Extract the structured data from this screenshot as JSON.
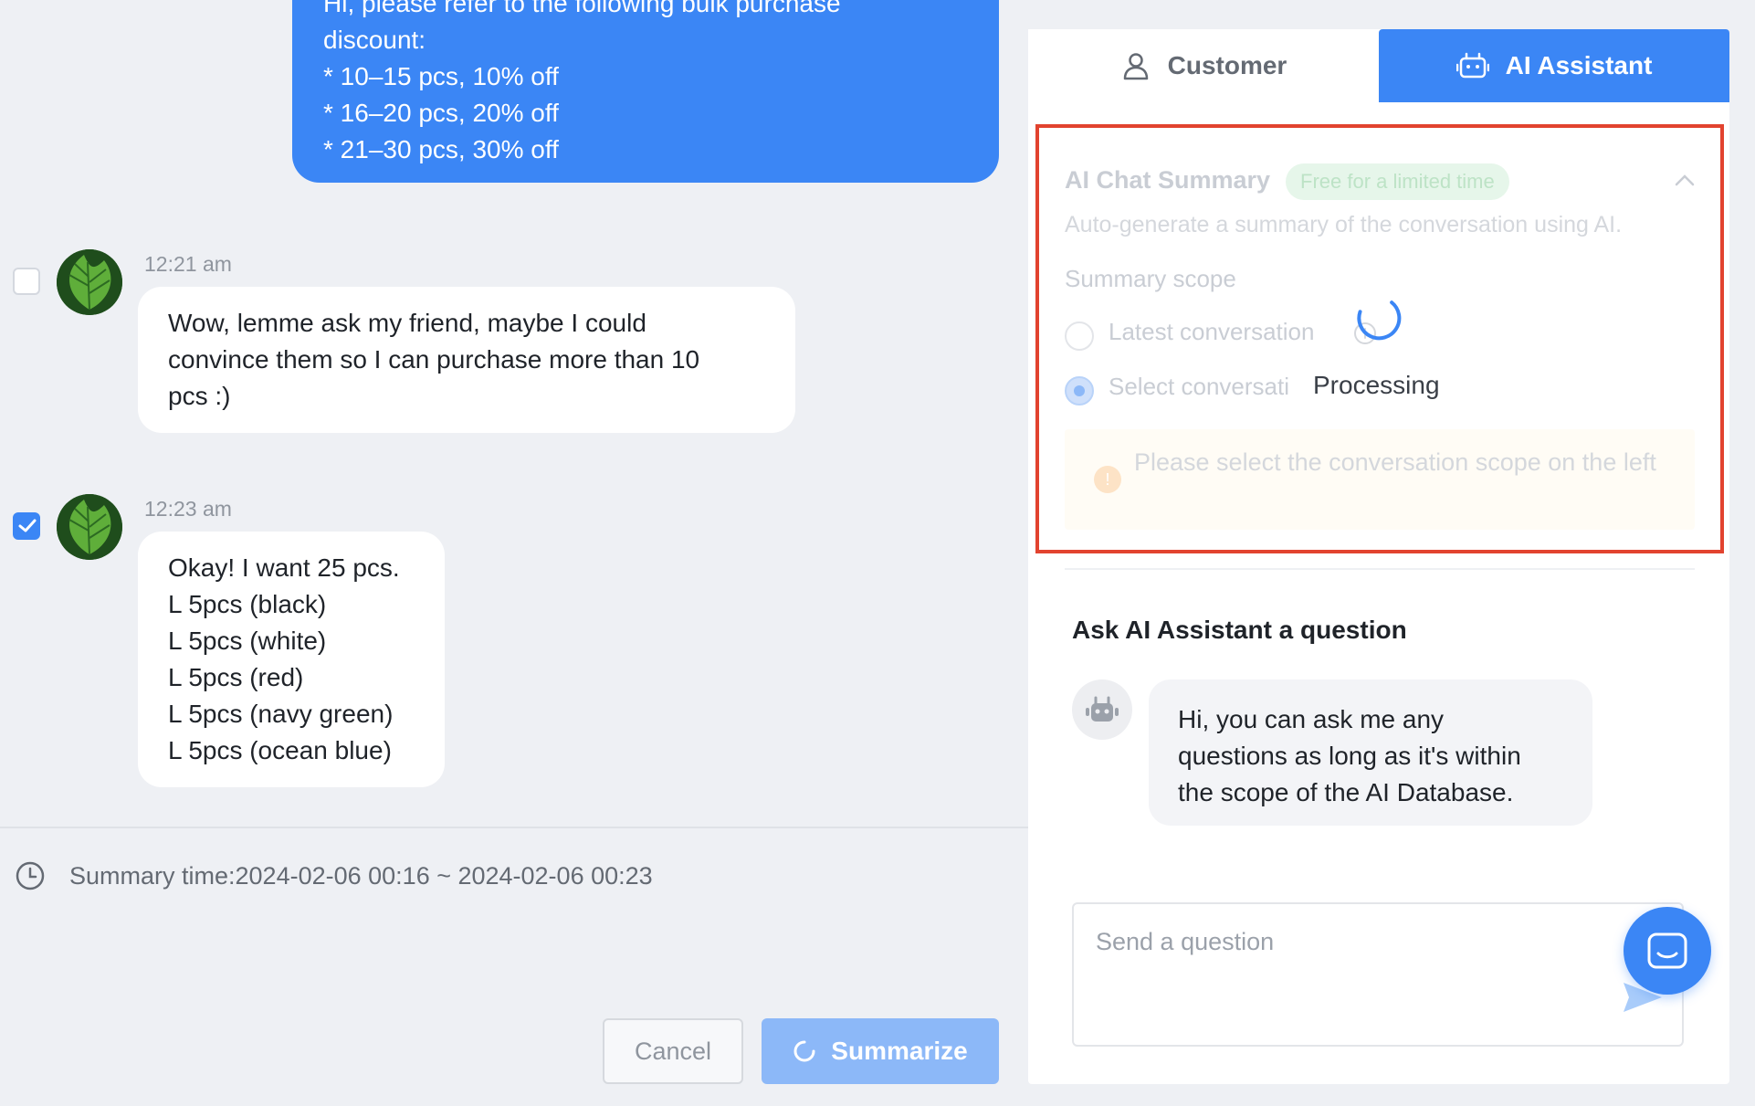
{
  "chat": {
    "agent_message": {
      "lines": [
        "Hi, please refer to the following bulk purchase",
        "discount:",
        "* 10–15 pcs, 10% off",
        "* 16–20 pcs, 20% off",
        "* 21–30 pcs, 30% off"
      ]
    },
    "messages": [
      {
        "time": "12:21 am",
        "checked": false,
        "lines": [
          "Wow, lemme ask my friend, maybe I could",
          "convince them so I can purchase more than 10",
          "pcs :)"
        ]
      },
      {
        "time": "12:23 am",
        "checked": true,
        "lines": [
          "Okay! I want 25 pcs.",
          "L 5pcs (black)",
          "L 5pcs (white)",
          "L 5pcs (red)",
          "L 5pcs (navy green)",
          "L 5pcs (ocean blue)"
        ]
      }
    ],
    "summary_time": "Summary time:2024-02-06 00:16 ~ 2024-02-06 00:23",
    "cancel_label": "Cancel",
    "summarize_label": "Summarize"
  },
  "panel": {
    "tabs": [
      {
        "label": "Customer",
        "icon": "user-icon",
        "active": false
      },
      {
        "label": "AI Assistant",
        "icon": "robot-icon",
        "active": true
      }
    ],
    "summary": {
      "title": "AI Chat Summary",
      "badge": "Free for a limited time",
      "description": "Auto-generate a summary of the conversation using AI.",
      "scope_label": "Summary scope",
      "option_latest": "Latest conversation",
      "option_select": "Select conversati",
      "warning": "Please select the conversation scope on the left",
      "processing": "Processing"
    },
    "ask": {
      "title": "Ask AI Assistant a question",
      "bot_message_lines": [
        "Hi, you can ask me any",
        "questions as long as it's within",
        "the scope of the AI Database."
      ],
      "input_placeholder": "Send a question"
    }
  },
  "colors": {
    "primary": "#3b86f5",
    "highlight": "#e2432f",
    "badge_bg": "#e6f6ea"
  }
}
